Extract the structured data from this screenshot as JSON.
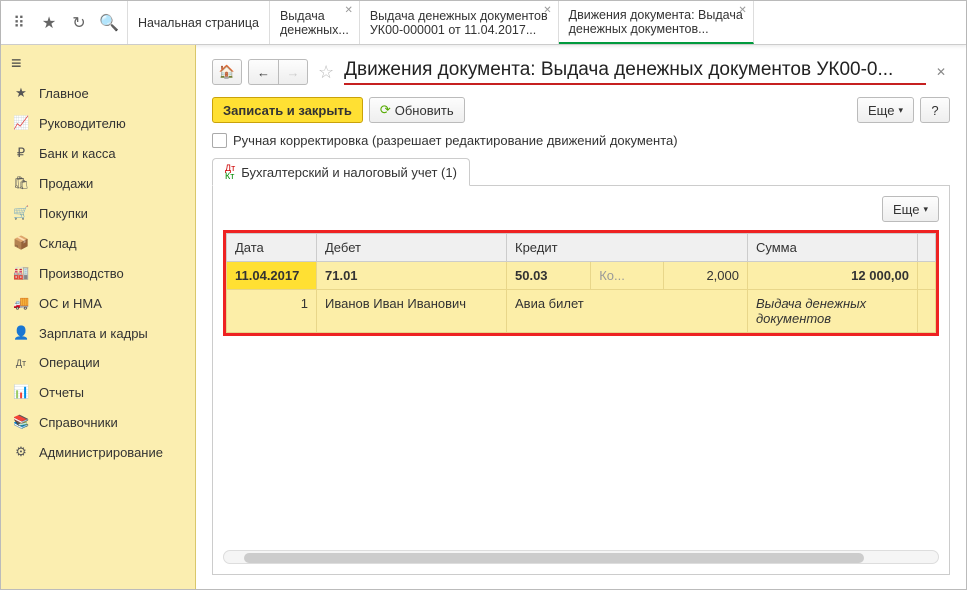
{
  "tabs": [
    {
      "line1": "Начальная страница",
      "line2": ""
    },
    {
      "line1": "Выдача",
      "line2": "денежных..."
    },
    {
      "line1": "Выдача денежных документов",
      "line2": "УК00-000001 от 11.04.2017..."
    },
    {
      "line1": "Движения документа: Выдача",
      "line2": "денежных документов..."
    }
  ],
  "sidebar": {
    "items": [
      {
        "icon": "★",
        "label": "Главное"
      },
      {
        "icon": "📈",
        "label": "Руководителю"
      },
      {
        "icon": "₽",
        "label": "Банк и касса"
      },
      {
        "icon": "🛍",
        "label": "Продажи"
      },
      {
        "icon": "🛒",
        "label": "Покупки"
      },
      {
        "icon": "📦",
        "label": "Склад"
      },
      {
        "icon": "🏭",
        "label": "Производство"
      },
      {
        "icon": "🚚",
        "label": "ОС и НМА"
      },
      {
        "icon": "👤",
        "label": "Зарплата и кадры"
      },
      {
        "icon": "Дт",
        "label": "Операции"
      },
      {
        "icon": "📊",
        "label": "Отчеты"
      },
      {
        "icon": "📚",
        "label": "Справочники"
      },
      {
        "icon": "⚙",
        "label": "Администрирование"
      }
    ]
  },
  "page": {
    "title": "Движения документа: Выдача денежных документов УК00-0...",
    "save_close": "Записать и закрыть",
    "refresh": "Обновить",
    "more": "Еще",
    "help": "?",
    "checkbox_label": "Ручная корректировка (разрешает редактирование движений документа)",
    "doc_tab": "Бухгалтерский и налоговый учет (1)"
  },
  "grid": {
    "headers": {
      "date": "Дата",
      "debit": "Дебет",
      "credit": "Кредит",
      "sum": "Сумма"
    },
    "row1": {
      "date": "11.04.2017",
      "debit": "71.01",
      "credit": "50.03",
      "credit_k": "Ко...",
      "credit_q": "2,000",
      "sum": "12 000,00"
    },
    "row2": {
      "n": "1",
      "debit": "Иванов Иван Иванович",
      "credit": "Авиа билет",
      "sum": "Выдача денежных документов"
    }
  }
}
